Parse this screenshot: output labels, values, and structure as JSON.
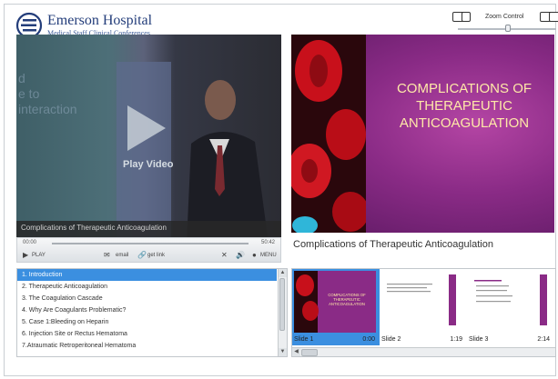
{
  "header": {
    "org_name": "Emerson Hospital",
    "subtitle": "Medical Staff Clinical Conferences",
    "zoom_label": "Zoom Control"
  },
  "video": {
    "ghost_text": "d\ne to\ninteraction",
    "play_label": "Play Video",
    "caption": "Complications of Therapeutic Anticoagulation",
    "time_current": "00:00",
    "time_total": "50:42",
    "controls": {
      "play": "PLAY",
      "email": "email",
      "get_link": "get link",
      "menu": "MENU"
    }
  },
  "slide": {
    "title": "COMPLICATIONS OF THERAPEUTIC ANTICOAGULATION",
    "caption": "Complications of Therapeutic Anticoagulation"
  },
  "chapters": [
    "1. Introduction",
    "2. Therapeutic Anticoagulation",
    "3. The Coagulation Cascade",
    "4. Why Are Coagulants Problematic?",
    "5. Case 1:Bleeding on Heparin",
    "6. Injection Site or Rectus Hematoma",
    "7.Atraumatic Retroperitoneal Hematoma"
  ],
  "thumbnails": [
    {
      "label": "Slide 1",
      "time": "0:00",
      "text": "COMPLICATIONS OF THERAPEUTIC ANTICOAGULATION"
    },
    {
      "label": "Slide 2",
      "time": "1:19"
    },
    {
      "label": "Slide 3",
      "time": "2:14"
    }
  ],
  "colors": {
    "accent": "#3b8fe0",
    "brand": "#233d7a",
    "slide_title": "#ffe9a8"
  }
}
